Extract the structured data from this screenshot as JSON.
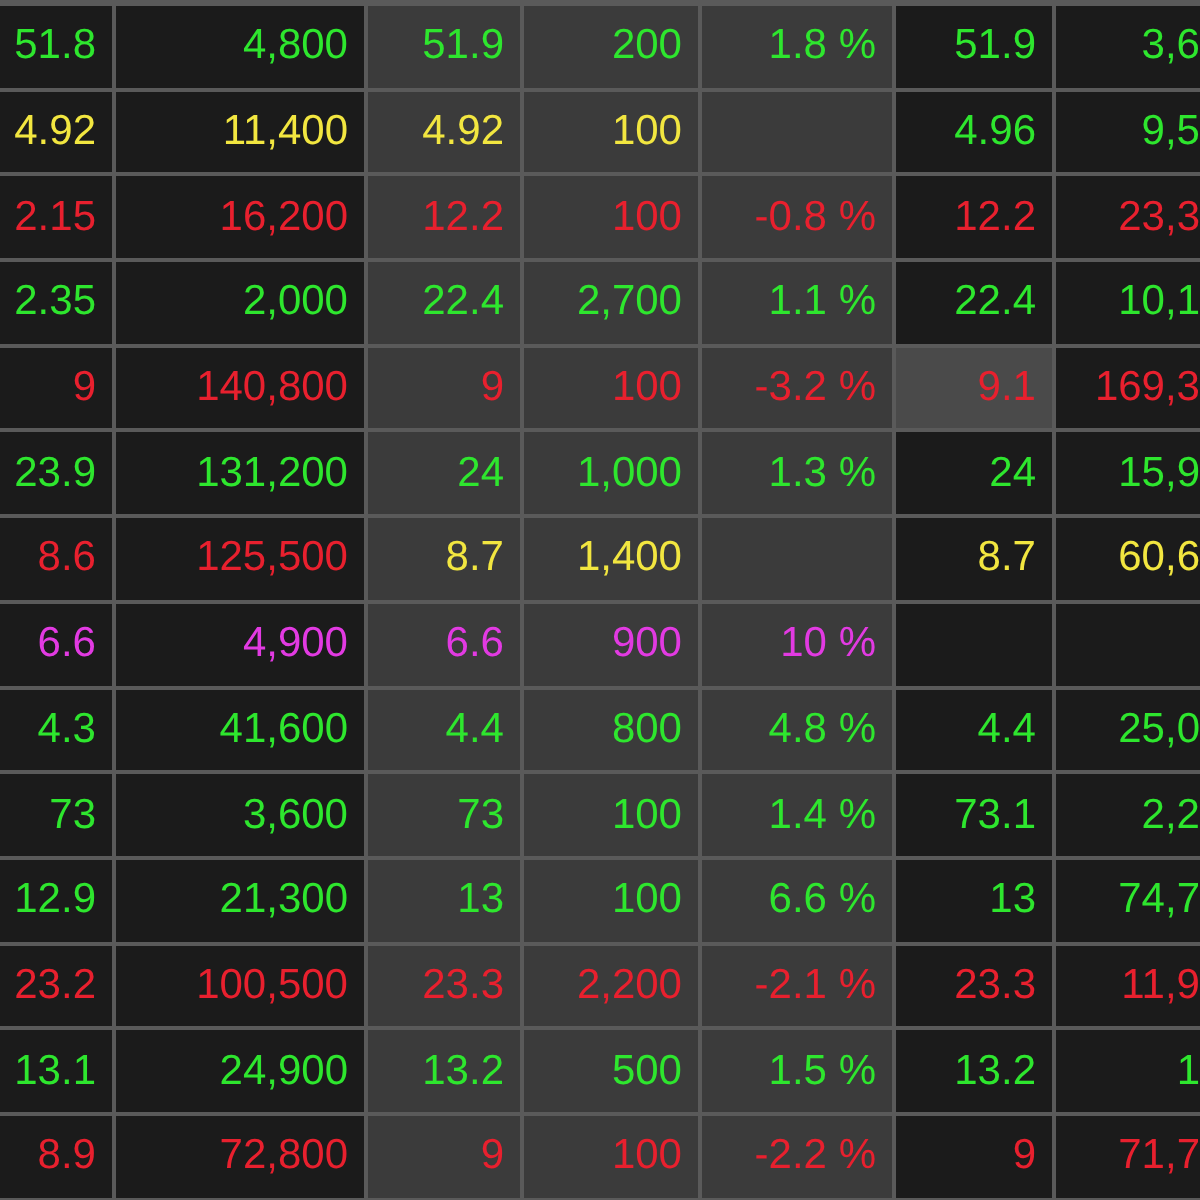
{
  "rows": [
    {
      "cells": [
        {
          "text": "51.8",
          "kind": "up",
          "highlighted": false
        },
        {
          "text": "4,800",
          "kind": "up",
          "highlighted": false
        },
        {
          "text": "51.9",
          "kind": "up",
          "highlighted": false
        },
        {
          "text": "200",
          "kind": "up",
          "highlighted": false
        },
        {
          "text": "1.8 %",
          "kind": "up",
          "highlighted": false
        },
        {
          "text": "51.9",
          "kind": "up",
          "highlighted": false
        },
        {
          "text": "3,6",
          "kind": "up",
          "highlighted": false
        }
      ]
    },
    {
      "cells": [
        {
          "text": "4.92",
          "kind": "ref",
          "highlighted": false
        },
        {
          "text": "11,400",
          "kind": "ref",
          "highlighted": false
        },
        {
          "text": "4.92",
          "kind": "ref",
          "highlighted": false
        },
        {
          "text": "100",
          "kind": "ref",
          "highlighted": false
        },
        {
          "highlighted": false
        },
        {
          "text": "4.96",
          "kind": "up",
          "highlighted": false
        },
        {
          "text": "9,5",
          "kind": "up",
          "highlighted": false
        }
      ]
    },
    {
      "cells": [
        {
          "text": "2.15",
          "kind": "down",
          "highlighted": false
        },
        {
          "text": "16,200",
          "kind": "down",
          "highlighted": false
        },
        {
          "text": "12.2",
          "kind": "down",
          "highlighted": false
        },
        {
          "text": "100",
          "kind": "down",
          "highlighted": false
        },
        {
          "text": "-0.8 %",
          "kind": "down",
          "highlighted": false
        },
        {
          "text": "12.2",
          "kind": "down",
          "highlighted": false
        },
        {
          "text": "23,3",
          "kind": "down",
          "highlighted": false
        }
      ]
    },
    {
      "cells": [
        {
          "text": "2.35",
          "kind": "up",
          "highlighted": false
        },
        {
          "text": "2,000",
          "kind": "up",
          "highlighted": false
        },
        {
          "text": "22.4",
          "kind": "up",
          "highlighted": false
        },
        {
          "text": "2,700",
          "kind": "up",
          "highlighted": false
        },
        {
          "text": "1.1 %",
          "kind": "up",
          "highlighted": false
        },
        {
          "text": "22.4",
          "kind": "up",
          "highlighted": false
        },
        {
          "text": "10,1",
          "kind": "up",
          "highlighted": false
        }
      ]
    },
    {
      "cells": [
        {
          "text": "9",
          "kind": "down",
          "highlighted": false
        },
        {
          "text": "140,800",
          "kind": "down",
          "highlighted": false
        },
        {
          "text": "9",
          "kind": "down",
          "highlighted": false
        },
        {
          "text": "100",
          "kind": "down",
          "highlighted": false
        },
        {
          "text": "-3.2 %",
          "kind": "down",
          "highlighted": false
        },
        {
          "text": "9.1",
          "kind": "down",
          "highlighted": true
        },
        {
          "text": "169,3",
          "kind": "down",
          "highlighted": false
        }
      ]
    },
    {
      "cells": [
        {
          "text": "23.9",
          "kind": "up",
          "highlighted": false
        },
        {
          "text": "131,200",
          "kind": "up",
          "highlighted": false
        },
        {
          "text": "24",
          "kind": "up",
          "highlighted": false
        },
        {
          "text": "1,000",
          "kind": "up",
          "highlighted": false
        },
        {
          "text": "1.3 %",
          "kind": "up",
          "highlighted": false
        },
        {
          "text": "24",
          "kind": "up",
          "highlighted": false
        },
        {
          "text": "15,9",
          "kind": "up",
          "highlighted": false
        }
      ]
    },
    {
      "cells": [
        {
          "text": "8.6",
          "kind": "down",
          "highlighted": false
        },
        {
          "text": "125,500",
          "kind": "down",
          "highlighted": false
        },
        {
          "text": "8.7",
          "kind": "ref",
          "highlighted": false
        },
        {
          "text": "1,400",
          "kind": "ref",
          "highlighted": false
        },
        {
          "highlighted": false
        },
        {
          "text": "8.7",
          "kind": "ref",
          "highlighted": false
        },
        {
          "text": "60,6",
          "kind": "ref",
          "highlighted": false
        }
      ]
    },
    {
      "cells": [
        {
          "text": "6.6",
          "kind": "ceiling",
          "highlighted": false
        },
        {
          "text": "4,900",
          "kind": "ceiling",
          "highlighted": false
        },
        {
          "text": "6.6",
          "kind": "ceiling",
          "highlighted": false
        },
        {
          "text": "900",
          "kind": "ceiling",
          "highlighted": false
        },
        {
          "text": "10 %",
          "kind": "ceiling",
          "highlighted": false
        },
        {
          "highlighted": false
        },
        {
          "highlighted": false
        }
      ]
    },
    {
      "cells": [
        {
          "text": "4.3",
          "kind": "up",
          "highlighted": false
        },
        {
          "text": "41,600",
          "kind": "up",
          "highlighted": false
        },
        {
          "text": "4.4",
          "kind": "up",
          "highlighted": false
        },
        {
          "text": "800",
          "kind": "up",
          "highlighted": false
        },
        {
          "text": "4.8 %",
          "kind": "up",
          "highlighted": false
        },
        {
          "text": "4.4",
          "kind": "up",
          "highlighted": false
        },
        {
          "text": "25,0",
          "kind": "up",
          "highlighted": false
        }
      ]
    },
    {
      "cells": [
        {
          "text": "73",
          "kind": "up",
          "highlighted": false
        },
        {
          "text": "3,600",
          "kind": "up",
          "highlighted": false
        },
        {
          "text": "73",
          "kind": "up",
          "highlighted": false
        },
        {
          "text": "100",
          "kind": "up",
          "highlighted": false
        },
        {
          "text": "1.4 %",
          "kind": "up",
          "highlighted": false
        },
        {
          "text": "73.1",
          "kind": "up",
          "highlighted": false
        },
        {
          "text": "2,2",
          "kind": "up",
          "highlighted": false
        }
      ]
    },
    {
      "cells": [
        {
          "text": "12.9",
          "kind": "up",
          "highlighted": false
        },
        {
          "text": "21,300",
          "kind": "up",
          "highlighted": false
        },
        {
          "text": "13",
          "kind": "up",
          "highlighted": false
        },
        {
          "text": "100",
          "kind": "up",
          "highlighted": false
        },
        {
          "text": "6.6 %",
          "kind": "up",
          "highlighted": false
        },
        {
          "text": "13",
          "kind": "up",
          "highlighted": false
        },
        {
          "text": "74,7",
          "kind": "up",
          "highlighted": false
        }
      ]
    },
    {
      "cells": [
        {
          "text": "23.2",
          "kind": "down",
          "highlighted": false
        },
        {
          "text": "100,500",
          "kind": "down",
          "highlighted": false
        },
        {
          "text": "23.3",
          "kind": "down",
          "highlighted": false
        },
        {
          "text": "2,200",
          "kind": "down",
          "highlighted": false
        },
        {
          "text": "-2.1 %",
          "kind": "down",
          "highlighted": false
        },
        {
          "text": "23.3",
          "kind": "down",
          "highlighted": false
        },
        {
          "text": "11,9",
          "kind": "down",
          "highlighted": false
        }
      ]
    },
    {
      "cells": [
        {
          "text": "13.1",
          "kind": "up",
          "highlighted": false
        },
        {
          "text": "24,900",
          "kind": "up",
          "highlighted": false
        },
        {
          "text": "13.2",
          "kind": "up",
          "highlighted": false
        },
        {
          "text": "500",
          "kind": "up",
          "highlighted": false
        },
        {
          "text": "1.5 %",
          "kind": "up",
          "highlighted": false
        },
        {
          "text": "13.2",
          "kind": "up",
          "highlighted": false
        },
        {
          "text": "1",
          "kind": "up",
          "highlighted": false
        }
      ]
    },
    {
      "cells": [
        {
          "text": "8.9",
          "kind": "down",
          "highlighted": false
        },
        {
          "text": "72,800",
          "kind": "down",
          "highlighted": false
        },
        {
          "text": "9",
          "kind": "down",
          "highlighted": false
        },
        {
          "text": "100",
          "kind": "down",
          "highlighted": false
        },
        {
          "text": "-2.2 %",
          "kind": "down",
          "highlighted": false
        },
        {
          "text": "9",
          "kind": "down",
          "highlighted": false
        },
        {
          "text": "71,7",
          "kind": "down",
          "highlighted": false
        }
      ]
    }
  ]
}
